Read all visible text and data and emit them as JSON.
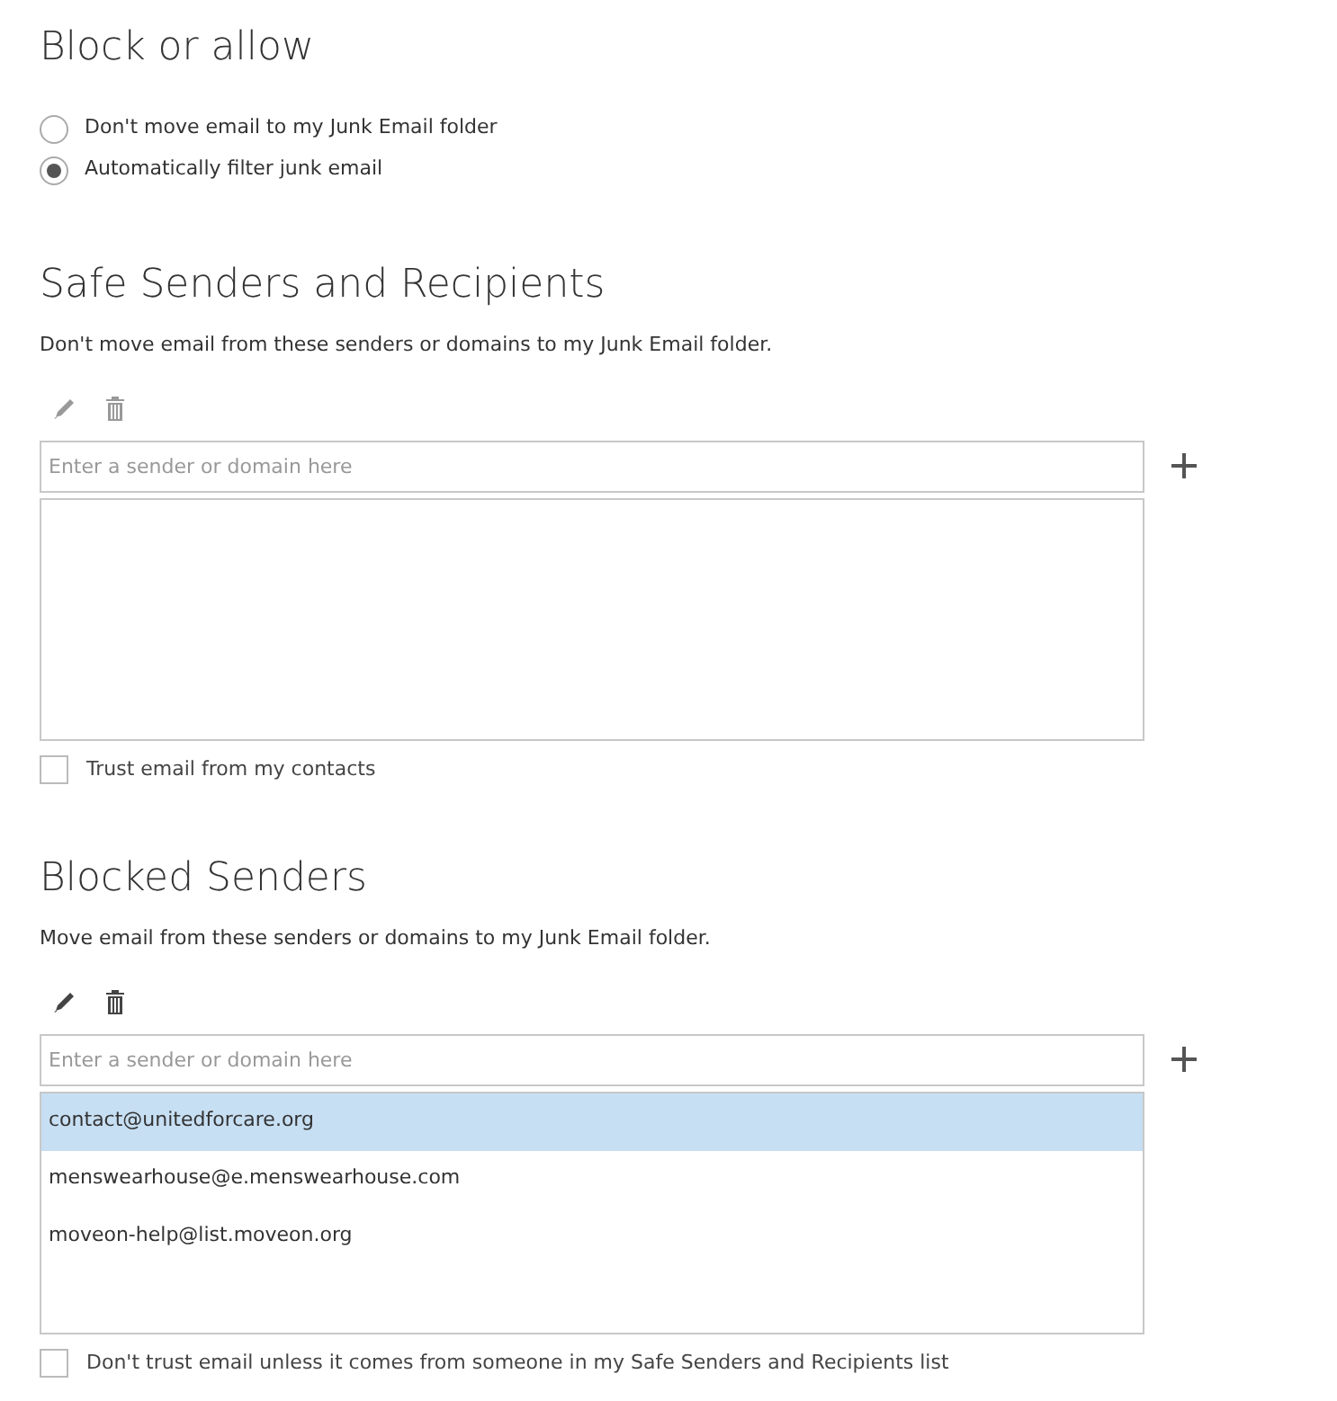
{
  "title": "Block or allow",
  "filter_options": [
    {
      "label": "Don't move email to my Junk Email folder",
      "selected": false
    },
    {
      "label": "Automatically filter junk email",
      "selected": true
    }
  ],
  "sections": [
    {
      "title": "Safe Senders and Recipients",
      "description": "Don't move email from these senders or domains to my Junk Email folder.",
      "tools_disabled": true,
      "input": {
        "placeholder": "Enter a sender or domain here"
      },
      "option": {
        "label": "Trust email from my contacts",
        "checked": false
      }
    },
    {
      "title": "Blocked Senders",
      "description": "Move email from these senders or domains to my Junk Email folder.",
      "tools_disabled": false,
      "input": {
        "placeholder": "Enter a sender or domain here"
      },
      "entries": [
        {
          "address": "contact@unitedforcare.org",
          "selected": true
        },
        {
          "address": "menswearhouse@e.menswearhouse.com",
          "selected": false
        },
        {
          "address": "moveon-help@list.moveon.org",
          "selected": false
        }
      ],
      "option": {
        "label": "Don't trust email unless it comes from someone in my Safe Senders and Recipients list",
        "checked": false
      }
    }
  ]
}
